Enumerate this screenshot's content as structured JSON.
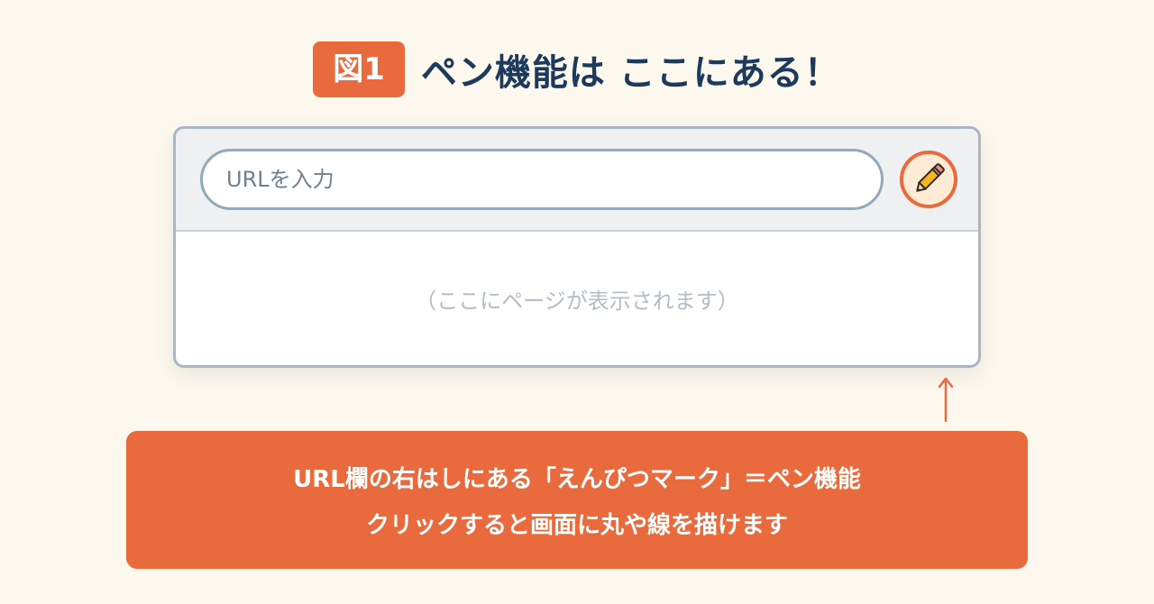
{
  "header": {
    "badge": "図1",
    "title": "ペン機能は ここにある！"
  },
  "browser": {
    "url_placeholder": "URLを入力",
    "pen_button_icon": "pencil-icon",
    "content_placeholder": "（ここにページが表示されます）"
  },
  "callout": {
    "line1": "URL欄の右はしにある「えんぴつマーク」＝ペン機能",
    "line2": "クリックすると画面に丸や線を描けます"
  },
  "colors": {
    "accent": "#e96a3c",
    "title": "#1d3a5c",
    "background": "#fdf8ee",
    "border": "#a9b7c3"
  }
}
